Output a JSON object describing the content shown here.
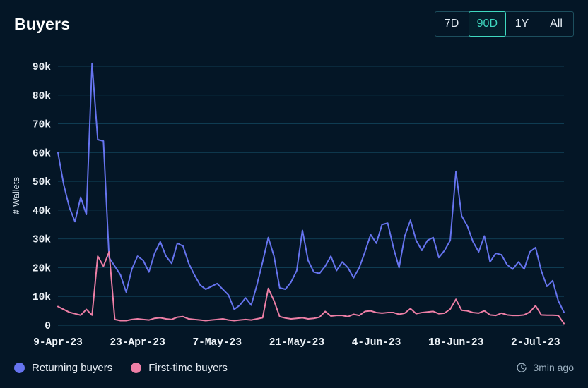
{
  "header": {
    "title": "Buyers",
    "ranges": [
      {
        "label": "7D",
        "active": false
      },
      {
        "label": "90D",
        "active": true
      },
      {
        "label": "1Y",
        "active": false
      },
      {
        "label": "All",
        "active": false
      }
    ]
  },
  "legend": [
    {
      "label": "Returning buyers",
      "color": "#6674ef"
    },
    {
      "label": "First-time buyers",
      "color": "#ee7fa6"
    }
  ],
  "footer": {
    "updated_text": "3min ago",
    "refresh_icon": "clock-refresh-icon"
  },
  "colors": {
    "background": "#041626",
    "accent": "#3fd9c0",
    "grid": "#0f3c52",
    "returning": "#6674ef",
    "first_time": "#ee7fa6"
  },
  "chart_data": {
    "type": "line",
    "title": "Buyers",
    "xlabel": "",
    "ylabel": "# Wallets",
    "ylim": [
      0,
      90000
    ],
    "yticks": [
      0,
      10000,
      20000,
      30000,
      40000,
      50000,
      60000,
      70000,
      80000,
      90000
    ],
    "ytick_labels": [
      "0",
      "10k",
      "20k",
      "30k",
      "40k",
      "50k",
      "60k",
      "70k",
      "80k",
      "90k"
    ],
    "xtick_labels": [
      "9-Apr-23",
      "23-Apr-23",
      "7-May-23",
      "21-May-23",
      "4-Jun-23",
      "18-Jun-23",
      "2-Jul-23"
    ],
    "xtick_indices": [
      0,
      14,
      28,
      42,
      56,
      70,
      84
    ],
    "x_start": "9-Apr-23",
    "x_end": "7-Jul-23",
    "n_points": 90,
    "grid": true,
    "legend_position": "bottom-left",
    "series": [
      {
        "name": "Returning buyers",
        "color": "#6674ef",
        "values": [
          60000,
          49000,
          41000,
          36000,
          44500,
          38500,
          91000,
          64500,
          64000,
          23500,
          20500,
          17500,
          11500,
          19500,
          24000,
          22500,
          18500,
          25000,
          29000,
          24000,
          21500,
          28500,
          27500,
          21500,
          17500,
          14000,
          12500,
          13500,
          14500,
          12500,
          10500,
          5500,
          7000,
          9500,
          7000,
          14000,
          22000,
          30500,
          24000,
          13000,
          12500,
          15000,
          19000,
          33000,
          22500,
          18500,
          18000,
          20500,
          24000,
          19000,
          22000,
          20000,
          16500,
          20000,
          25500,
          31500,
          28500,
          35000,
          35500,
          27000,
          20000,
          31000,
          36500,
          29500,
          26000,
          29500,
          30500,
          23500,
          26000,
          29500,
          53500,
          38000,
          34500,
          29000,
          25500,
          31000,
          22000,
          25000,
          24500,
          21000,
          19500,
          22000,
          19500,
          25500,
          27000,
          19000,
          13500,
          15500,
          8500,
          4500
        ]
      },
      {
        "name": "First-time buyers",
        "color": "#ee7fa6",
        "values": [
          6500,
          5500,
          4500,
          4000,
          3500,
          5500,
          3500,
          24000,
          20500,
          25500,
          2000,
          1600,
          1600,
          2000,
          2200,
          2000,
          1800,
          2400,
          2600,
          2200,
          2000,
          2800,
          3000,
          2200,
          2000,
          1800,
          1600,
          1800,
          2000,
          2200,
          1800,
          1600,
          1800,
          2000,
          1800,
          2200,
          2600,
          12800,
          8500,
          3000,
          2500,
          2200,
          2400,
          2600,
          2200,
          2400,
          2800,
          4800,
          3200,
          3400,
          3400,
          3000,
          3800,
          3400,
          4800,
          5000,
          4400,
          4200,
          4400,
          4400,
          3800,
          4200,
          5800,
          4000,
          4400,
          4600,
          4800,
          4000,
          4200,
          5600,
          9000,
          5200,
          5000,
          4400,
          4200,
          5000,
          3600,
          3400,
          4200,
          3600,
          3400,
          3400,
          3600,
          4600,
          6800,
          3600,
          3500,
          3500,
          3400,
          600
        ]
      }
    ]
  }
}
